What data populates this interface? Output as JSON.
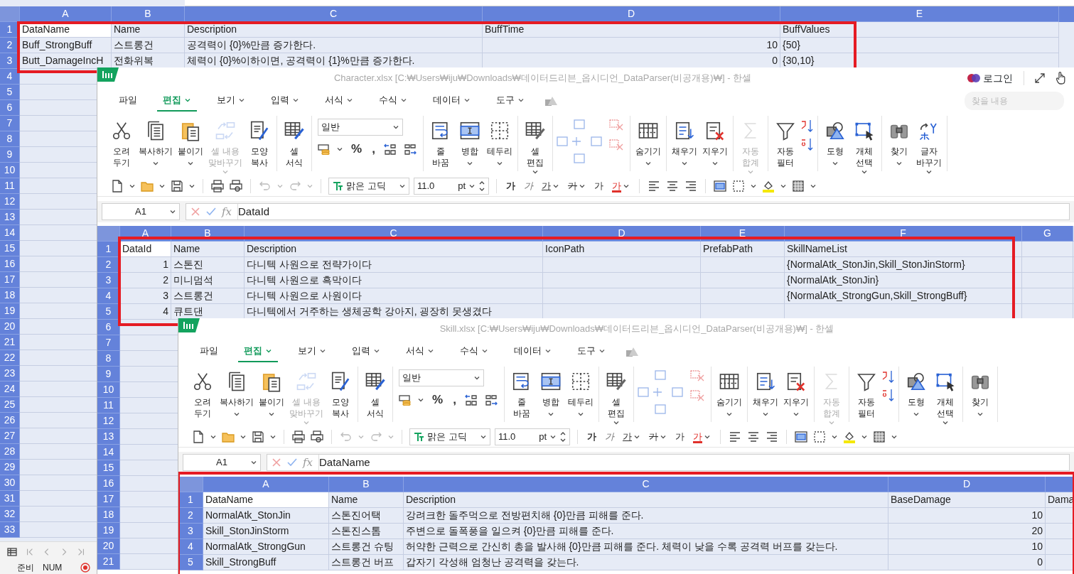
{
  "background_sheet": {
    "column_headers": [
      "A",
      "B",
      "C",
      "D",
      "E"
    ],
    "row_numbers": [
      "1",
      "2",
      "3",
      "4",
      "5",
      "6",
      "7",
      "8",
      "9",
      "10",
      "11",
      "12",
      "13",
      "14",
      "15",
      "16",
      "17",
      "18",
      "19",
      "20",
      "21",
      "22",
      "23",
      "24",
      "25",
      "26",
      "27",
      "28",
      "29",
      "30",
      "31",
      "32",
      "33"
    ],
    "rows": [
      [
        {
          "text": "DataName",
          "kind": "active"
        },
        "Name",
        "Description",
        "BuffTime",
        "BuffValues"
      ],
      [
        "Buff_StrongBuff",
        "스트롱건",
        "공격력이 {0}%만큼 증가한다.",
        {
          "text": "10",
          "kind": "number"
        },
        "{50}"
      ],
      [
        "Butt_DamageIncH",
        "전화위복",
        "체력이 {0}%이하이면, 공격력이 {1}%만큼 증가한다.",
        {
          "text": "0",
          "kind": "number"
        },
        "{30,10}"
      ]
    ],
    "highlighted": true,
    "status_bar": [
      "준비",
      "NUM"
    ]
  },
  "windows": [
    {
      "title": "Character.xlsx [C:₩Users₩iju₩Downloads₩데이터드리븐_옵시디언_DataParser(비공개용)₩] - 한셀",
      "account": {
        "label": "로그인"
      },
      "search": {
        "placeholder": "찾을 내용"
      },
      "menu_tabs": [
        {
          "label": "파일",
          "selected": false,
          "menu": false
        },
        {
          "label": "편집",
          "selected": true,
          "menu": true
        },
        {
          "label": "보기",
          "selected": false,
          "menu": true
        },
        {
          "label": "입력",
          "selected": false,
          "menu": true
        },
        {
          "label": "서식",
          "selected": false,
          "menu": true
        },
        {
          "label": "수식",
          "selected": false,
          "menu": true
        },
        {
          "label": "데이터",
          "selected": false,
          "menu": true
        },
        {
          "label": "도구",
          "selected": false,
          "menu": true
        }
      ],
      "ribbon": [
        [
          {
            "kind": "button",
            "label": "오려\n두기",
            "menu": false,
            "disabled": false
          },
          {
            "kind": "button",
            "label": "복사하기",
            "menu": true,
            "disabled": false
          },
          {
            "kind": "button",
            "label": "붙이기",
            "menu": true,
            "disabled": false
          },
          {
            "kind": "button",
            "label": "셀 내용\n맞바꾸기",
            "menu": true,
            "disabled": true
          },
          {
            "kind": "button",
            "label": "모양\n복사",
            "menu": false,
            "disabled": false
          }
        ],
        [
          {
            "kind": "button",
            "label": "셀\n서식",
            "menu": false,
            "disabled": false
          }
        ],
        [
          {
            "kind": "format",
            "value": "일반",
            "symbols": [
              "%",
              ","
            ]
          }
        ],
        [
          {
            "kind": "button",
            "label": "줄\n바꿈",
            "menu": false,
            "disabled": false
          },
          {
            "kind": "button",
            "label": "병합",
            "menu": true,
            "disabled": false
          },
          {
            "kind": "button",
            "label": "테두리",
            "menu": true,
            "disabled": false
          }
        ],
        [
          {
            "kind": "button",
            "label": "셀\n편집",
            "menu": true,
            "disabled": false
          }
        ],
        [
          {
            "kind": "cells"
          }
        ],
        [
          {
            "kind": "button",
            "label": "숨기기",
            "menu": true,
            "disabled": false
          }
        ],
        [
          {
            "kind": "button",
            "label": "채우기",
            "menu": true,
            "disabled": false
          },
          {
            "kind": "button",
            "label": "지우기",
            "menu": true,
            "disabled": false
          }
        ],
        [
          {
            "kind": "button",
            "label": "자동\n합계",
            "menu": true,
            "disabled": true
          }
        ],
        [
          {
            "kind": "button",
            "label": "자동\n필터",
            "menu": false,
            "disabled": false
          },
          {
            "kind": "sort"
          }
        ],
        [
          {
            "kind": "button",
            "label": "도형",
            "menu": true,
            "disabled": false
          },
          {
            "kind": "button",
            "label": "개체\n선택",
            "menu": true,
            "disabled": false
          }
        ],
        [
          {
            "kind": "button",
            "label": "찾기",
            "menu": true,
            "disabled": false
          },
          {
            "kind": "button",
            "label": "글자\n바꾸기",
            "menu": true,
            "disabled": false
          }
        ]
      ],
      "quick_toolbar": {
        "font": "맑은 고딕",
        "size": "11.0",
        "unit": "pt",
        "text_buttons": [
          "가",
          "가",
          "가",
          "가",
          "가",
          "가"
        ]
      },
      "formula_bar": {
        "cell": "A1",
        "function_label": "fx",
        "value": "DataId"
      },
      "sheet": {
        "column_headers": [
          "A",
          "B",
          "C",
          "D",
          "E",
          "F",
          "G"
        ],
        "row_numbers": [
          "1",
          "2",
          "3",
          "4",
          "5",
          "6",
          "7",
          "8",
          "9",
          "10",
          "11",
          "12",
          "13",
          "14",
          "15",
          "16",
          "17",
          "18",
          "19",
          "20",
          "21"
        ],
        "rows": [
          [
            {
              "text": "DataId",
              "kind": "active"
            },
            "Name",
            "Description",
            "IconPath",
            "PrefabPath",
            "SkillNameList"
          ],
          [
            {
              "text": "1",
              "kind": "number"
            },
            "스톤진",
            "다니텍 사원으로 전략가이다",
            null,
            null,
            "{NormalAtk_StonJin,Skill_StonJinStorm}"
          ],
          [
            {
              "text": "2",
              "kind": "number"
            },
            "미니멈석",
            "다니텍 사원으로 흑막이다",
            null,
            null,
            "{NormalAtk_StonJin}"
          ],
          [
            {
              "text": "3",
              "kind": "number"
            },
            "스트롱건",
            "다니텍 사원으로 사원이다",
            null,
            null,
            "{NormalAtk_StrongGun,Skill_StrongBuff}"
          ],
          [
            {
              "text": "4",
              "kind": "number"
            },
            "큐트댄",
            "다니텍에서 거주하는 생체공학 강아지, 굉장히 못생겼다"
          ]
        ],
        "highlighted": true
      }
    },
    {
      "title": "Skill.xlsx [C:₩Users₩iju₩Downloads₩데이터드리븐_옵시디언_DataParser(비공개용)₩] - 한셀",
      "menu_tabs": [
        {
          "label": "파일",
          "selected": false,
          "menu": false
        },
        {
          "label": "편집",
          "selected": true,
          "menu": true
        },
        {
          "label": "보기",
          "selected": false,
          "menu": true
        },
        {
          "label": "입력",
          "selected": false,
          "menu": true
        },
        {
          "label": "서식",
          "selected": false,
          "menu": true
        },
        {
          "label": "수식",
          "selected": false,
          "menu": true
        },
        {
          "label": "데이터",
          "selected": false,
          "menu": true
        },
        {
          "label": "도구",
          "selected": false,
          "menu": true
        }
      ],
      "ribbon": [
        [
          {
            "kind": "button",
            "label": "오려\n두기",
            "menu": false,
            "disabled": false
          },
          {
            "kind": "button",
            "label": "복사하기",
            "menu": true,
            "disabled": false
          },
          {
            "kind": "button",
            "label": "붙이기",
            "menu": true,
            "disabled": false
          },
          {
            "kind": "button",
            "label": "셀 내용\n맞바꾸기",
            "menu": true,
            "disabled": true
          },
          {
            "kind": "button",
            "label": "모양\n복사",
            "menu": false,
            "disabled": false
          }
        ],
        [
          {
            "kind": "button",
            "label": "셀\n서식",
            "menu": false,
            "disabled": false
          }
        ],
        [
          {
            "kind": "format",
            "value": "일반",
            "symbols": [
              "%",
              ","
            ]
          }
        ],
        [
          {
            "kind": "button",
            "label": "줄\n바꿈",
            "menu": false,
            "disabled": false
          },
          {
            "kind": "button",
            "label": "병합",
            "menu": true,
            "disabled": false
          },
          {
            "kind": "button",
            "label": "테두리",
            "menu": true,
            "disabled": false
          }
        ],
        [
          {
            "kind": "button",
            "label": "셀\n편집",
            "menu": true,
            "disabled": false
          }
        ],
        [
          {
            "kind": "cells"
          }
        ],
        [
          {
            "kind": "button",
            "label": "숨기기",
            "menu": true,
            "disabled": false
          }
        ],
        [
          {
            "kind": "button",
            "label": "채우기",
            "menu": true,
            "disabled": false
          },
          {
            "kind": "button",
            "label": "지우기",
            "menu": true,
            "disabled": false
          }
        ],
        [
          {
            "kind": "button",
            "label": "자동\n합계",
            "menu": true,
            "disabled": true
          }
        ],
        [
          {
            "kind": "button",
            "label": "자동\n필터",
            "menu": false,
            "disabled": false
          },
          {
            "kind": "sort"
          }
        ],
        [
          {
            "kind": "button",
            "label": "도형",
            "menu": true,
            "disabled": false
          },
          {
            "kind": "button",
            "label": "개체\n선택",
            "menu": true,
            "disabled": false
          }
        ],
        [
          {
            "kind": "button",
            "label": "찾기",
            "menu": true,
            "disabled": false
          }
        ]
      ],
      "quick_toolbar": {
        "font": "맑은 고딕",
        "size": "11.0",
        "unit": "pt",
        "text_buttons": [
          "가",
          "가",
          "가",
          "가",
          "가",
          "가"
        ]
      },
      "formula_bar": {
        "cell": "A1",
        "function_label": "fx",
        "value": "DataName"
      },
      "sheet": {
        "column_headers": [
          "A",
          "B",
          "C",
          "D"
        ],
        "row_numbers": [
          "1",
          "2",
          "3",
          "4",
          "5"
        ],
        "rows": [
          [
            {
              "text": "DataName",
              "kind": "active"
            },
            "Name",
            "Description",
            "BaseDamage",
            "Dama"
          ],
          [
            "NormalAtk_StonJin",
            "스톤진어택",
            "강려크한 돌주먹으로 전방편치해 {0}만큼 피해를 준다.",
            {
              "text": "10",
              "kind": "number"
            }
          ],
          [
            "Skill_StonJinStorm",
            "스톤진스톰",
            "주변으로 돌폭풍을 일으켜 {0}만큼 피해를 준다.",
            {
              "text": "20",
              "kind": "number"
            }
          ],
          [
            "NormalAtk_StrongGun",
            "스트롱건 슈팅",
            "허약한 근력으로 간신히 총을 발사해 {0}만큼 피해를 준다. 체력이 낮을 수록 공격력 버프를 갖는다.",
            {
              "text": "10",
              "kind": "number"
            }
          ],
          [
            "Skill_StrongBuff",
            "스트롱건 버프",
            "갑자기 각성해 엄청난 공격력을 갖는다.",
            {
              "text": "0",
              "kind": "number"
            }
          ]
        ],
        "highlighted": true
      }
    }
  ]
}
